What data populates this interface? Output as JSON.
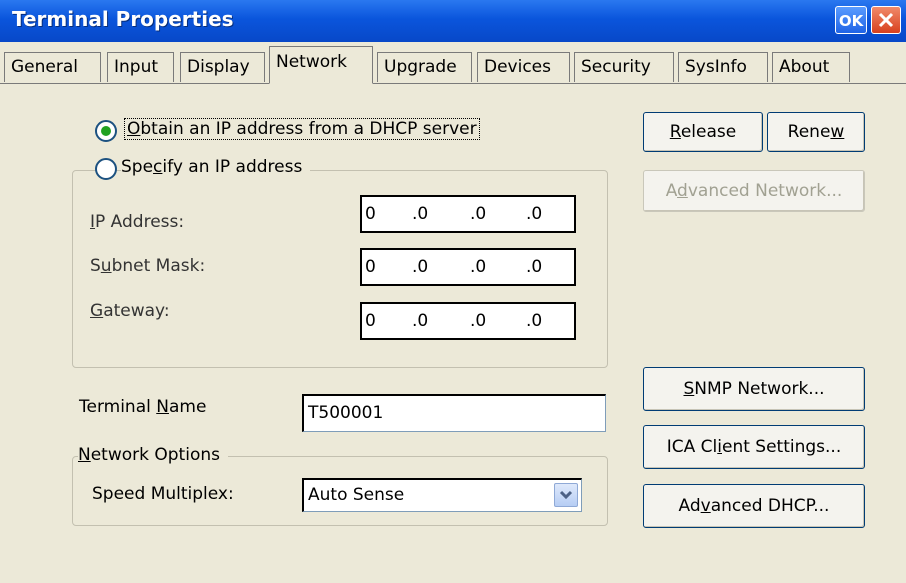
{
  "window": {
    "title": "Terminal Properties",
    "ok_label": "OK",
    "accent": "#0a55dc"
  },
  "tabs": [
    {
      "label": "General",
      "active": false
    },
    {
      "label": "Input",
      "active": false
    },
    {
      "label": "Display",
      "active": false
    },
    {
      "label": "Network",
      "active": true
    },
    {
      "label": "Upgrade",
      "active": false
    },
    {
      "label": "Devices",
      "active": false
    },
    {
      "label": "Security",
      "active": false
    },
    {
      "label": "SysInfo",
      "active": false
    },
    {
      "label": "About",
      "active": false
    }
  ],
  "ip_mode": {
    "dhcp": {
      "pre": "",
      "key": "O",
      "post": "btain an IP address from a DHCP server",
      "selected": true
    },
    "static": {
      "pre": "Spe",
      "key": "c",
      "post": "ify an IP address",
      "selected": false
    }
  },
  "fields": {
    "ip": {
      "pre": "",
      "key": "I",
      "post": "P Address:",
      "octets": [
        "0",
        ".0",
        ".0",
        ".0"
      ]
    },
    "subnet": {
      "pre": "S",
      "key": "u",
      "post": "bnet Mask:",
      "octets": [
        "0",
        ".0",
        ".0",
        ".0"
      ]
    },
    "gateway": {
      "pre": "",
      "key": "G",
      "post": "ateway:",
      "octets": [
        "0",
        ".0",
        ".0",
        ".0"
      ]
    }
  },
  "buttons": {
    "release": {
      "pre": "",
      "key": "R",
      "post": "elease"
    },
    "renew": {
      "pre": "Rene",
      "key": "w",
      "post": ""
    },
    "advanced_network": {
      "pre": "A",
      "key": "d",
      "post": "vanced Network...",
      "enabled": false
    },
    "snmp": {
      "pre": "",
      "key": "S",
      "post": "NMP Network..."
    },
    "ica": {
      "pre": "ICA Cl",
      "key": "i",
      "post": "ent Settings..."
    },
    "adv_dhcp": {
      "pre": "Ad",
      "key": "v",
      "post": "anced DHCP..."
    }
  },
  "terminal_name": {
    "pre": "Terminal ",
    "key": "N",
    "post": "ame",
    "value": "T500001"
  },
  "network_options": {
    "pre": "",
    "key": "N",
    "post": "etwork Options",
    "speed_label": "Speed Multiplex:",
    "speed_value": "Auto Sense"
  }
}
